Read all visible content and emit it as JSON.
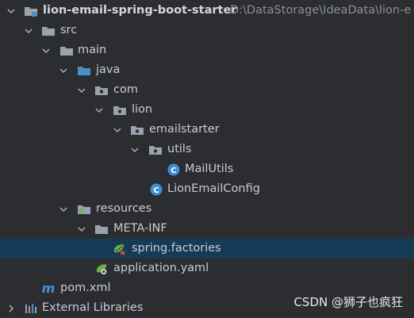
{
  "project": {
    "name": "lion-email-spring-boot-starter",
    "path": "D:\\DataStorage\\IdeaData\\lion-e"
  },
  "tree": {
    "src": "src",
    "main": "main",
    "java": "java",
    "com": "com",
    "lion": "lion",
    "emailstarter": "emailstarter",
    "utils": "utils",
    "mailutils": "MailUtils",
    "lionemailconfig": "LionEmailConfig",
    "resources": "resources",
    "metainf": "META-INF",
    "springfactories": "spring.factories",
    "applicationyaml": "application.yaml",
    "pomxml": "pom.xml",
    "externallibraries": "External Libraries"
  },
  "icon_glyphs": {
    "class_icon": "C",
    "maven_icon": "m",
    "arrow_expanded": "⌄",
    "arrow_collapsed": "›"
  },
  "colors": {
    "background": "#2b2d30",
    "selection": "#153b57",
    "folder": "#9aa3ad",
    "source_folder": "#4b8fc9",
    "class_icon": "#3d8fd8",
    "spring_green": "#6ab04c",
    "maven_blue": "#4a90d9"
  },
  "watermark": "CSDN @狮子也疯狂"
}
